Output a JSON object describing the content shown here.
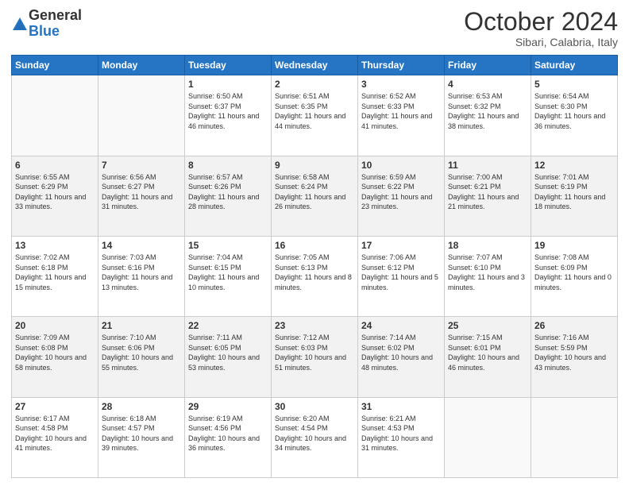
{
  "logo": {
    "general": "General",
    "blue": "Blue"
  },
  "title": "October 2024",
  "subtitle": "Sibari, Calabria, Italy",
  "days_header": [
    "Sunday",
    "Monday",
    "Tuesday",
    "Wednesday",
    "Thursday",
    "Friday",
    "Saturday"
  ],
  "weeks": [
    [
      {
        "day": "",
        "info": ""
      },
      {
        "day": "",
        "info": ""
      },
      {
        "day": "1",
        "sunrise": "Sunrise: 6:50 AM",
        "sunset": "Sunset: 6:37 PM",
        "daylight": "Daylight: 11 hours and 46 minutes."
      },
      {
        "day": "2",
        "sunrise": "Sunrise: 6:51 AM",
        "sunset": "Sunset: 6:35 PM",
        "daylight": "Daylight: 11 hours and 44 minutes."
      },
      {
        "day": "3",
        "sunrise": "Sunrise: 6:52 AM",
        "sunset": "Sunset: 6:33 PM",
        "daylight": "Daylight: 11 hours and 41 minutes."
      },
      {
        "day": "4",
        "sunrise": "Sunrise: 6:53 AM",
        "sunset": "Sunset: 6:32 PM",
        "daylight": "Daylight: 11 hours and 38 minutes."
      },
      {
        "day": "5",
        "sunrise": "Sunrise: 6:54 AM",
        "sunset": "Sunset: 6:30 PM",
        "daylight": "Daylight: 11 hours and 36 minutes."
      }
    ],
    [
      {
        "day": "6",
        "sunrise": "Sunrise: 6:55 AM",
        "sunset": "Sunset: 6:29 PM",
        "daylight": "Daylight: 11 hours and 33 minutes."
      },
      {
        "day": "7",
        "sunrise": "Sunrise: 6:56 AM",
        "sunset": "Sunset: 6:27 PM",
        "daylight": "Daylight: 11 hours and 31 minutes."
      },
      {
        "day": "8",
        "sunrise": "Sunrise: 6:57 AM",
        "sunset": "Sunset: 6:26 PM",
        "daylight": "Daylight: 11 hours and 28 minutes."
      },
      {
        "day": "9",
        "sunrise": "Sunrise: 6:58 AM",
        "sunset": "Sunset: 6:24 PM",
        "daylight": "Daylight: 11 hours and 26 minutes."
      },
      {
        "day": "10",
        "sunrise": "Sunrise: 6:59 AM",
        "sunset": "Sunset: 6:22 PM",
        "daylight": "Daylight: 11 hours and 23 minutes."
      },
      {
        "day": "11",
        "sunrise": "Sunrise: 7:00 AM",
        "sunset": "Sunset: 6:21 PM",
        "daylight": "Daylight: 11 hours and 21 minutes."
      },
      {
        "day": "12",
        "sunrise": "Sunrise: 7:01 AM",
        "sunset": "Sunset: 6:19 PM",
        "daylight": "Daylight: 11 hours and 18 minutes."
      }
    ],
    [
      {
        "day": "13",
        "sunrise": "Sunrise: 7:02 AM",
        "sunset": "Sunset: 6:18 PM",
        "daylight": "Daylight: 11 hours and 15 minutes."
      },
      {
        "day": "14",
        "sunrise": "Sunrise: 7:03 AM",
        "sunset": "Sunset: 6:16 PM",
        "daylight": "Daylight: 11 hours and 13 minutes."
      },
      {
        "day": "15",
        "sunrise": "Sunrise: 7:04 AM",
        "sunset": "Sunset: 6:15 PM",
        "daylight": "Daylight: 11 hours and 10 minutes."
      },
      {
        "day": "16",
        "sunrise": "Sunrise: 7:05 AM",
        "sunset": "Sunset: 6:13 PM",
        "daylight": "Daylight: 11 hours and 8 minutes."
      },
      {
        "day": "17",
        "sunrise": "Sunrise: 7:06 AM",
        "sunset": "Sunset: 6:12 PM",
        "daylight": "Daylight: 11 hours and 5 minutes."
      },
      {
        "day": "18",
        "sunrise": "Sunrise: 7:07 AM",
        "sunset": "Sunset: 6:10 PM",
        "daylight": "Daylight: 11 hours and 3 minutes."
      },
      {
        "day": "19",
        "sunrise": "Sunrise: 7:08 AM",
        "sunset": "Sunset: 6:09 PM",
        "daylight": "Daylight: 11 hours and 0 minutes."
      }
    ],
    [
      {
        "day": "20",
        "sunrise": "Sunrise: 7:09 AM",
        "sunset": "Sunset: 6:08 PM",
        "daylight": "Daylight: 10 hours and 58 minutes."
      },
      {
        "day": "21",
        "sunrise": "Sunrise: 7:10 AM",
        "sunset": "Sunset: 6:06 PM",
        "daylight": "Daylight: 10 hours and 55 minutes."
      },
      {
        "day": "22",
        "sunrise": "Sunrise: 7:11 AM",
        "sunset": "Sunset: 6:05 PM",
        "daylight": "Daylight: 10 hours and 53 minutes."
      },
      {
        "day": "23",
        "sunrise": "Sunrise: 7:12 AM",
        "sunset": "Sunset: 6:03 PM",
        "daylight": "Daylight: 10 hours and 51 minutes."
      },
      {
        "day": "24",
        "sunrise": "Sunrise: 7:14 AM",
        "sunset": "Sunset: 6:02 PM",
        "daylight": "Daylight: 10 hours and 48 minutes."
      },
      {
        "day": "25",
        "sunrise": "Sunrise: 7:15 AM",
        "sunset": "Sunset: 6:01 PM",
        "daylight": "Daylight: 10 hours and 46 minutes."
      },
      {
        "day": "26",
        "sunrise": "Sunrise: 7:16 AM",
        "sunset": "Sunset: 5:59 PM",
        "daylight": "Daylight: 10 hours and 43 minutes."
      }
    ],
    [
      {
        "day": "27",
        "sunrise": "Sunrise: 6:17 AM",
        "sunset": "Sunset: 4:58 PM",
        "daylight": "Daylight: 10 hours and 41 minutes."
      },
      {
        "day": "28",
        "sunrise": "Sunrise: 6:18 AM",
        "sunset": "Sunset: 4:57 PM",
        "daylight": "Daylight: 10 hours and 39 minutes."
      },
      {
        "day": "29",
        "sunrise": "Sunrise: 6:19 AM",
        "sunset": "Sunset: 4:56 PM",
        "daylight": "Daylight: 10 hours and 36 minutes."
      },
      {
        "day": "30",
        "sunrise": "Sunrise: 6:20 AM",
        "sunset": "Sunset: 4:54 PM",
        "daylight": "Daylight: 10 hours and 34 minutes."
      },
      {
        "day": "31",
        "sunrise": "Sunrise: 6:21 AM",
        "sunset": "Sunset: 4:53 PM",
        "daylight": "Daylight: 10 hours and 31 minutes."
      },
      {
        "day": "",
        "info": ""
      },
      {
        "day": "",
        "info": ""
      }
    ]
  ]
}
